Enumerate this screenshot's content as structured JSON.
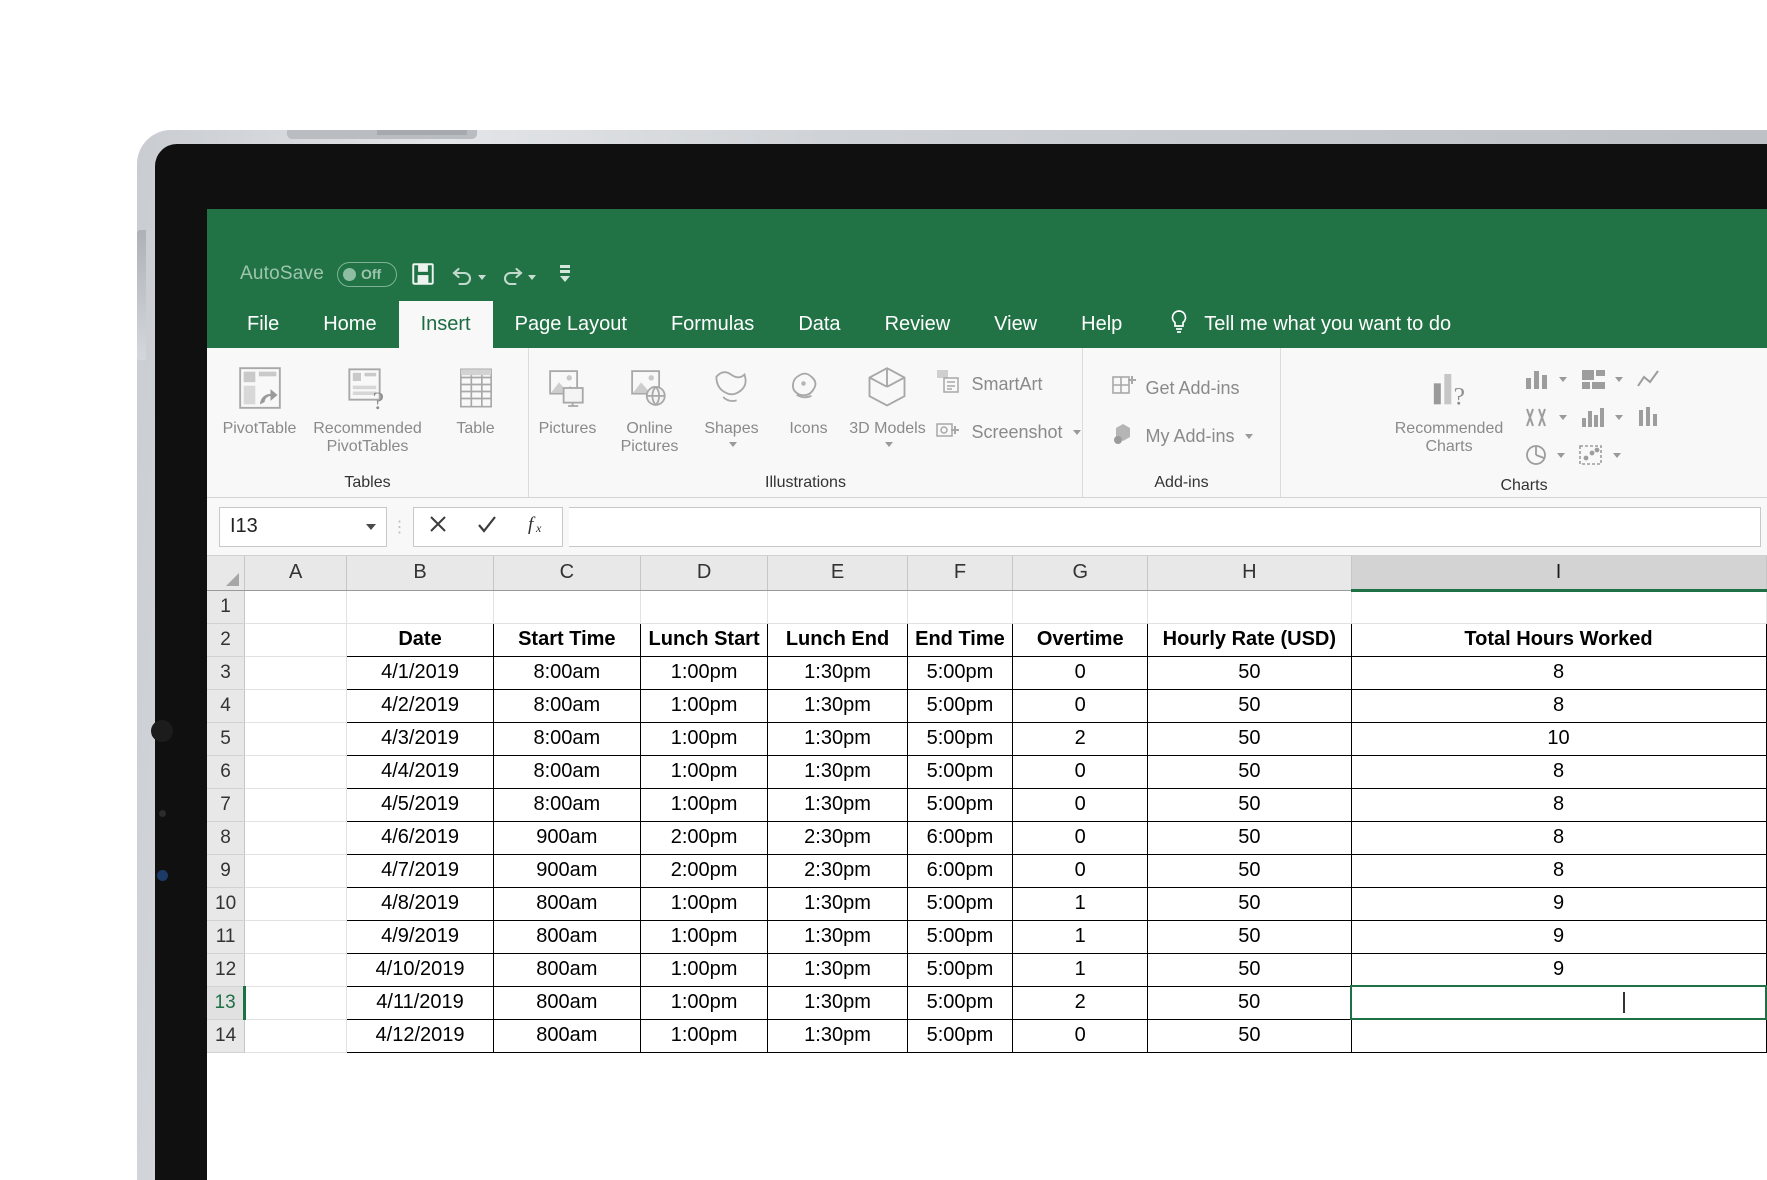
{
  "quick_access": {
    "autosave_label": "AutoSave",
    "autosave_state": "Off",
    "save_icon": "save-icon",
    "undo_icon": "undo-icon",
    "redo_icon": "redo-icon",
    "customize_icon": "customize-quick-access-icon"
  },
  "ribbon": {
    "tabs": [
      {
        "label": "File",
        "active": false
      },
      {
        "label": "Home",
        "active": false
      },
      {
        "label": "Insert",
        "active": true
      },
      {
        "label": "Page Layout",
        "active": false
      },
      {
        "label": "Formulas",
        "active": false
      },
      {
        "label": "Data",
        "active": false
      },
      {
        "label": "Review",
        "active": false
      },
      {
        "label": "View",
        "active": false
      },
      {
        "label": "Help",
        "active": false
      }
    ],
    "tell_me": "Tell me what you want to do",
    "groups": [
      {
        "label": "Tables",
        "buttons": [
          {
            "label": "PivotTable"
          },
          {
            "label": "Recommended PivotTables"
          },
          {
            "label": "Table"
          }
        ]
      },
      {
        "label": "Illustrations",
        "buttons": [
          {
            "label": "Pictures"
          },
          {
            "label": "Online Pictures"
          },
          {
            "label": "Shapes"
          },
          {
            "label": "Icons"
          },
          {
            "label": "3D Models"
          },
          {
            "label": "SmartArt"
          },
          {
            "label": "Screenshot"
          }
        ]
      },
      {
        "label": "Add-ins",
        "buttons": [
          {
            "label": "Get Add-ins"
          },
          {
            "label": "My Add-ins"
          }
        ]
      },
      {
        "label": "Charts",
        "buttons": [
          {
            "label": "Recommended Charts"
          }
        ]
      }
    ]
  },
  "formula_bar": {
    "name_box_value": "I13",
    "cancel_icon": "cancel-icon",
    "enter_icon": "enter-icon",
    "function_icon": "insert-function-icon",
    "formula_value": ""
  },
  "sheet": {
    "columns": [
      "A",
      "B",
      "C",
      "D",
      "E",
      "F",
      "G",
      "H",
      "I"
    ],
    "selected_column": "I",
    "active_row": 13,
    "selected_cell": "I13",
    "row_numbers": [
      1,
      2,
      3,
      4,
      5,
      6,
      7,
      8,
      9,
      10,
      11,
      12,
      13,
      14
    ],
    "table_headers": [
      "Date",
      "Start Time",
      "Lunch Start",
      "Lunch End",
      "End Time",
      "Overtime",
      "Hourly Rate (USD)",
      "Total Hours Worked"
    ],
    "rows": [
      {
        "n": 3,
        "cells": [
          "4/1/2019",
          "8:00am",
          "1:00pm",
          "1:30pm",
          "5:00pm",
          "0",
          "50",
          "8"
        ]
      },
      {
        "n": 4,
        "cells": [
          "4/2/2019",
          "8:00am",
          "1:00pm",
          "1:30pm",
          "5:00pm",
          "0",
          "50",
          "8"
        ]
      },
      {
        "n": 5,
        "cells": [
          "4/3/2019",
          "8:00am",
          "1:00pm",
          "1:30pm",
          "5:00pm",
          "2",
          "50",
          "10"
        ]
      },
      {
        "n": 6,
        "cells": [
          "4/4/2019",
          "8:00am",
          "1:00pm",
          "1:30pm",
          "5:00pm",
          "0",
          "50",
          "8"
        ]
      },
      {
        "n": 7,
        "cells": [
          "4/5/2019",
          "8:00am",
          "1:00pm",
          "1:30pm",
          "5:00pm",
          "0",
          "50",
          "8"
        ]
      },
      {
        "n": 8,
        "cells": [
          "4/6/2019",
          "900am",
          "2:00pm",
          "2:30pm",
          "6:00pm",
          "0",
          "50",
          "8"
        ]
      },
      {
        "n": 9,
        "cells": [
          "4/7/2019",
          "900am",
          "2:00pm",
          "2:30pm",
          "6:00pm",
          "0",
          "50",
          "8"
        ]
      },
      {
        "n": 10,
        "cells": [
          "4/8/2019",
          "800am",
          "1:00pm",
          "1:30pm",
          "5:00pm",
          "1",
          "50",
          "9"
        ]
      },
      {
        "n": 11,
        "cells": [
          "4/9/2019",
          "800am",
          "1:00pm",
          "1:30pm",
          "5:00pm",
          "1",
          "50",
          "9"
        ]
      },
      {
        "n": 12,
        "cells": [
          "4/10/2019",
          "800am",
          "1:00pm",
          "1:30pm",
          "5:00pm",
          "1",
          "50",
          "9"
        ]
      },
      {
        "n": 13,
        "cells": [
          "4/11/2019",
          "800am",
          "1:00pm",
          "1:30pm",
          "5:00pm",
          "2",
          "50",
          ""
        ]
      },
      {
        "n": 14,
        "cells": [
          "4/12/2019",
          "800am",
          "1:00pm",
          "1:30pm",
          "5:00pm",
          "0",
          "50",
          ""
        ]
      }
    ]
  },
  "colors": {
    "excel_green": "#217346",
    "selection_green": "#1e7145",
    "ribbon_bg": "#f8f8f8",
    "header_gray": "#e8e8e8"
  }
}
